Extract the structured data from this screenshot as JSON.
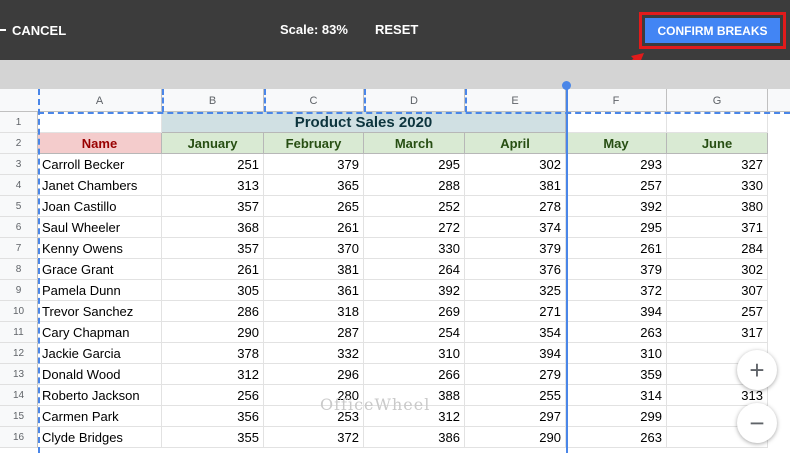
{
  "toolbar": {
    "cancel_label": "CANCEL",
    "scale_label": "Scale: 83%",
    "reset_label": "RESET",
    "confirm_label": "CONFIRM BREAKS"
  },
  "colors": {
    "topbar": "#3c3c3c",
    "confirm": "#4285f4",
    "highlight_box": "#e21b1b",
    "page_break": "#4a86e8"
  },
  "columns": [
    "A",
    "B",
    "C",
    "D",
    "E",
    "F",
    "G"
  ],
  "rows": [
    "1",
    "2",
    "3",
    "4",
    "5",
    "6",
    "7",
    "8",
    "9",
    "10",
    "11",
    "12",
    "13",
    "14",
    "15",
    "16"
  ],
  "sheet": {
    "title": "Product Sales 2020",
    "header_name": "Name",
    "months": [
      "January",
      "February",
      "March",
      "April",
      "May",
      "June"
    ],
    "data": [
      {
        "name": "Carroll Becker",
        "values": [
          "251",
          "379",
          "295",
          "302",
          "293",
          "327"
        ]
      },
      {
        "name": "Janet Chambers",
        "values": [
          "313",
          "365",
          "288",
          "381",
          "257",
          "330"
        ]
      },
      {
        "name": "Joan Castillo",
        "values": [
          "357",
          "265",
          "252",
          "278",
          "392",
          "380"
        ]
      },
      {
        "name": "Saul Wheeler",
        "values": [
          "368",
          "261",
          "272",
          "374",
          "295",
          "371"
        ]
      },
      {
        "name": "Kenny Owens",
        "values": [
          "357",
          "370",
          "330",
          "379",
          "261",
          "284"
        ]
      },
      {
        "name": "Grace Grant",
        "values": [
          "261",
          "381",
          "264",
          "376",
          "379",
          "302"
        ]
      },
      {
        "name": "Pamela Dunn",
        "values": [
          "305",
          "361",
          "392",
          "325",
          "372",
          "307"
        ]
      },
      {
        "name": "Trevor Sanchez",
        "values": [
          "286",
          "318",
          "269",
          "271",
          "394",
          "257"
        ]
      },
      {
        "name": "Cary Chapman",
        "values": [
          "290",
          "287",
          "254",
          "354",
          "263",
          "317"
        ]
      },
      {
        "name": "Jackie Garcia",
        "values": [
          "378",
          "332",
          "310",
          "394",
          "310",
          ""
        ]
      },
      {
        "name": "Donald Wood",
        "values": [
          "312",
          "296",
          "266",
          "279",
          "359",
          ""
        ]
      },
      {
        "name": "Roberto Jackson",
        "values": [
          "256",
          "280",
          "388",
          "255",
          "314",
          "313"
        ]
      },
      {
        "name": "Carmen Park",
        "values": [
          "356",
          "253",
          "312",
          "297",
          "299",
          ""
        ]
      },
      {
        "name": "Clyde Bridges",
        "values": [
          "355",
          "372",
          "386",
          "290",
          "263",
          ""
        ]
      }
    ]
  },
  "zoom": {
    "in_label": "+",
    "out_label": "−"
  },
  "watermark": "OfficeWheel"
}
